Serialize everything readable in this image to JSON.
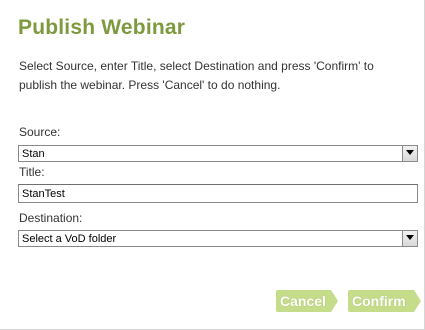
{
  "dialog": {
    "title": "Publish Webinar",
    "instructions": "Select Source, enter Title, select Destination and press 'Confirm' to publish the webinar. Press 'Cancel' to do nothing."
  },
  "form": {
    "source": {
      "label": "Source:",
      "selected": "Stan"
    },
    "title": {
      "label": "Title:",
      "value": "StanTest"
    },
    "destination": {
      "label": "Destination:",
      "selected": "Select a VoD folder"
    }
  },
  "buttons": {
    "cancel_label": "Cancel",
    "confirm_label": "Confirm"
  },
  "colors": {
    "title": "#7d9a3f",
    "button": "#c5dc8a"
  }
}
